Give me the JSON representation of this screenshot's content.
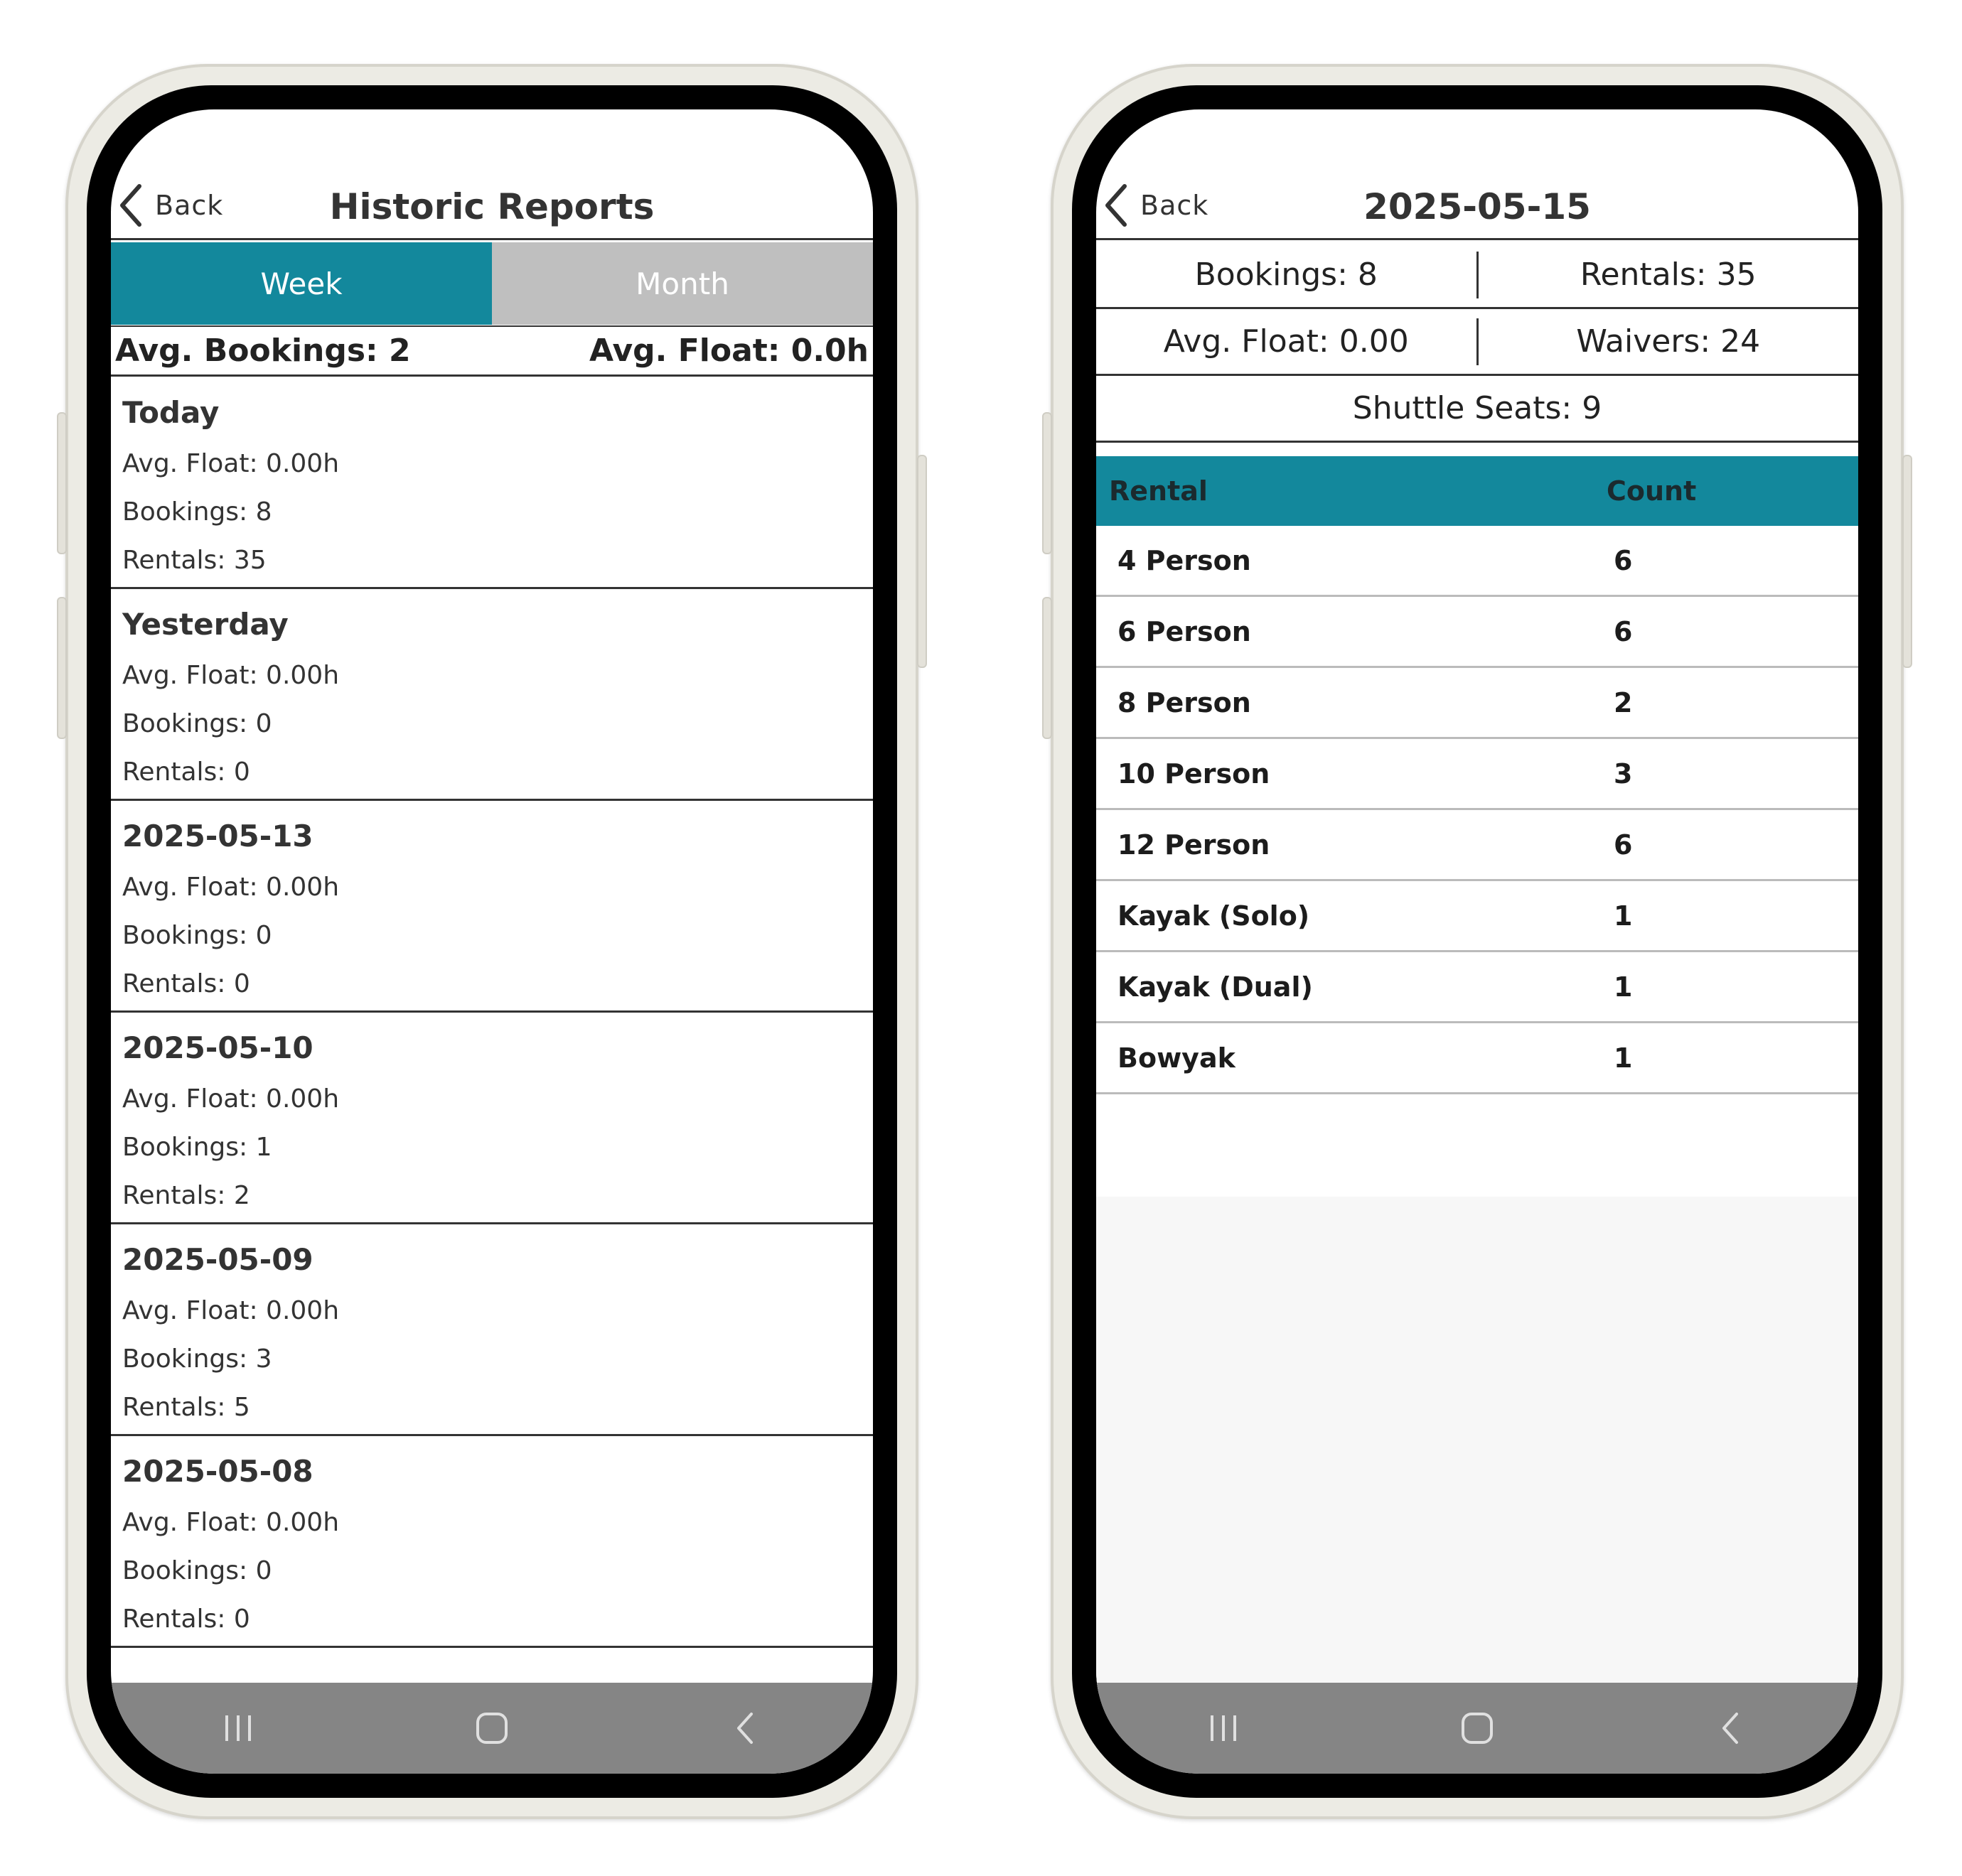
{
  "left_screen": {
    "back_label": "Back",
    "title": "Historic Reports",
    "tabs": [
      {
        "label": "Week",
        "active": true
      },
      {
        "label": "Month",
        "active": false
      }
    ],
    "summary": {
      "avg_bookings": "Avg. Bookings: 2",
      "avg_float": "Avg. Float: 0.0h"
    },
    "days": [
      {
        "title": "Today",
        "avg_float": "Avg. Float: 0.00h",
        "bookings": "Bookings: 8",
        "rentals": "Rentals: 35"
      },
      {
        "title": "Yesterday",
        "avg_float": "Avg. Float: 0.00h",
        "bookings": "Bookings: 0",
        "rentals": "Rentals: 0"
      },
      {
        "title": "2025-05-13",
        "avg_float": "Avg. Float: 0.00h",
        "bookings": "Bookings: 0",
        "rentals": "Rentals: 0"
      },
      {
        "title": "2025-05-10",
        "avg_float": "Avg. Float: 0.00h",
        "bookings": "Bookings: 1",
        "rentals": "Rentals: 2"
      },
      {
        "title": "2025-05-09",
        "avg_float": "Avg. Float: 0.00h",
        "bookings": "Bookings: 3",
        "rentals": "Rentals: 5"
      },
      {
        "title": "2025-05-08",
        "avg_float": "Avg. Float: 0.00h",
        "bookings": "Bookings: 0",
        "rentals": "Rentals: 0"
      }
    ]
  },
  "right_screen": {
    "back_label": "Back",
    "title": "2025-05-15",
    "stats": {
      "bookings": "Bookings: 8",
      "rentals": "Rentals: 35",
      "avg_float": "Avg. Float: 0.00",
      "waivers": "Waivers: 24",
      "shuttle_seats": "Shuttle Seats: 9"
    },
    "table": {
      "headers": [
        "Rental",
        "Count"
      ],
      "rows": [
        [
          "4 Person",
          "6"
        ],
        [
          "6 Person",
          "6"
        ],
        [
          "8 Person",
          "2"
        ],
        [
          "10 Person",
          "3"
        ],
        [
          "12 Person",
          "6"
        ],
        [
          "Kayak (Solo)",
          "1"
        ],
        [
          "Kayak (Dual)",
          "1"
        ],
        [
          "Bowyak",
          "1"
        ]
      ]
    }
  },
  "nav_icons": [
    "recent-apps-icon",
    "home-icon",
    "back-nav-icon"
  ],
  "colors": {
    "accent": "#13889c",
    "inactive_tab": "#bfbfbf",
    "nav_bar": "#858585",
    "phone_frame": "#ecebe4"
  }
}
